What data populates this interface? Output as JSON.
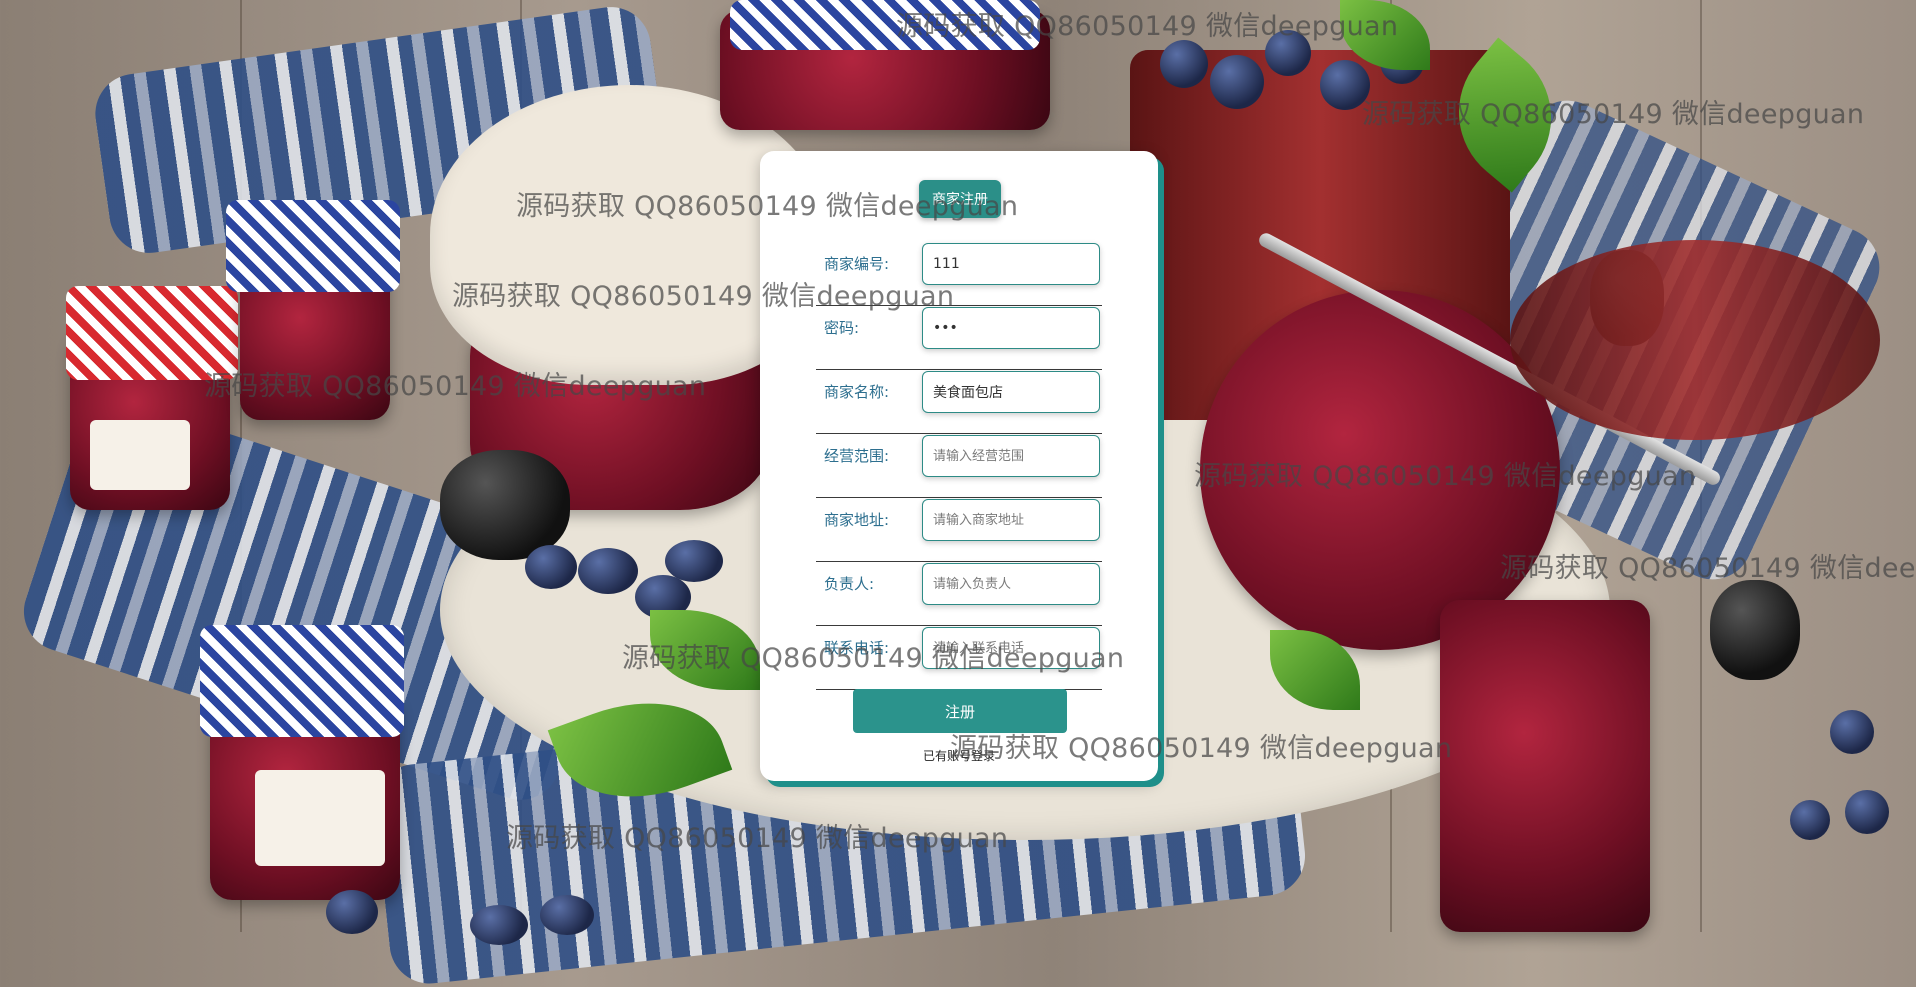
{
  "form": {
    "title": "商家注册",
    "fields": [
      {
        "label": "商家编号:",
        "value": "111",
        "placeholder": ""
      },
      {
        "label": "密码:",
        "value": "•••",
        "placeholder": ""
      },
      {
        "label": "商家名称:",
        "value": "美食面包店",
        "placeholder": ""
      },
      {
        "label": "经营范围:",
        "value": "",
        "placeholder": "请输入经营范围"
      },
      {
        "label": "商家地址:",
        "value": "",
        "placeholder": "请输入商家地址"
      },
      {
        "label": "负责人:",
        "value": "",
        "placeholder": "请输入负责人"
      },
      {
        "label": "联系电话:",
        "value": "",
        "placeholder": "请输入联系电话"
      }
    ],
    "submit_label": "注册",
    "login_link": "已有账号登录"
  },
  "watermark": "源码获取 QQ86050149 微信deepguan"
}
